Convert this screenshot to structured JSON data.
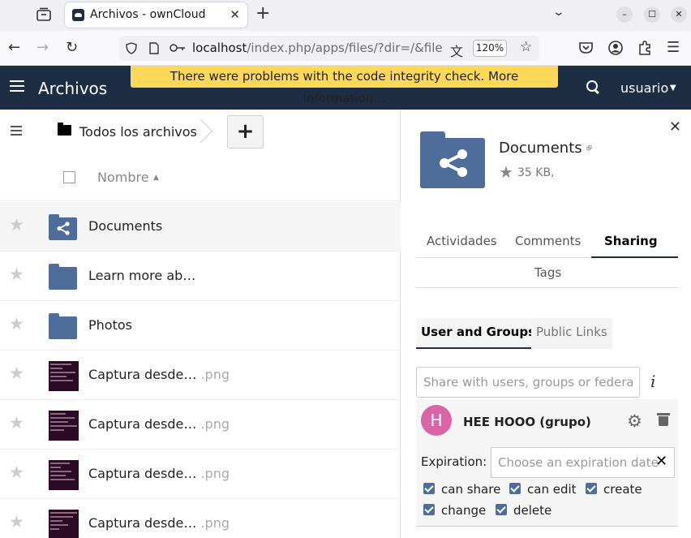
{
  "browser": {
    "tab_title": "Archivos - ownCloud",
    "url_host": "localhost",
    "url_path": "/index.php/apps/files/?dir=/&fileid=",
    "zoom": "120%"
  },
  "header": {
    "app_name": "Archivos",
    "warning": "There were problems with the code integrity check. More information…",
    "user": "usuario"
  },
  "files": {
    "breadcrumb": "Todos los archivos",
    "new_label": "+",
    "column_name": "Nombre",
    "rows": [
      {
        "name": "Documents",
        "ext": "",
        "type": "shared-folder"
      },
      {
        "name": "Learn more ab…",
        "ext": "",
        "type": "folder"
      },
      {
        "name": "Photos",
        "ext": "",
        "type": "folder"
      },
      {
        "name": "Captura desde…",
        "ext": " .png",
        "type": "image"
      },
      {
        "name": "Captura desde…",
        "ext": " .png",
        "type": "image"
      },
      {
        "name": "Captura desde…",
        "ext": " .png",
        "type": "image"
      },
      {
        "name": "Captura desde…",
        "ext": " .png",
        "type": "image"
      }
    ]
  },
  "sidebar": {
    "title": "Documents",
    "meta": "35 KB,",
    "tabs": [
      "Actividades",
      "Comments",
      "Sharing",
      "Tags"
    ],
    "subtabs": [
      "User and Groups",
      "Public Links"
    ],
    "share_placeholder": "Share with users, groups or federated cloud users",
    "share": {
      "avatar_letter": "H",
      "name": "HEE HOOO (grupo)",
      "expiration_label": "Expiration:",
      "expiration_placeholder": "Choose an expiration date",
      "permissions": [
        "can share",
        "can edit",
        "create",
        "change",
        "delete"
      ]
    }
  }
}
